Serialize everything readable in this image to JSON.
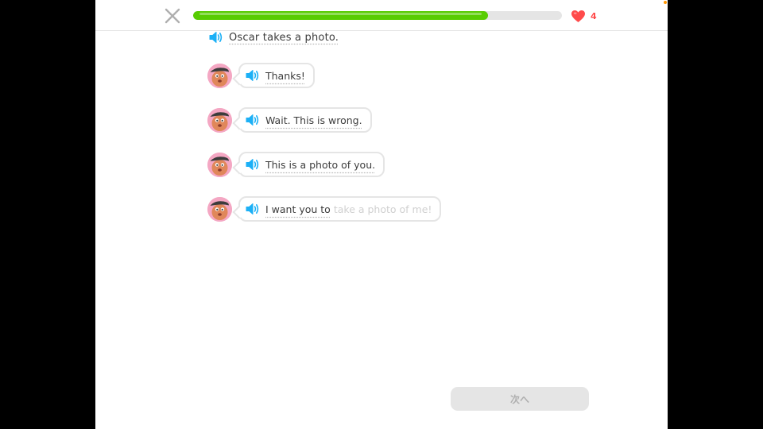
{
  "header": {
    "progress_fraction": 0.8,
    "hearts": "4",
    "colors": {
      "progress": "#58cc02",
      "heart": "#ff4b4b"
    }
  },
  "prompt": {
    "icon": "speaker-icon",
    "text": "Oscar takes a photo."
  },
  "dialogue": [
    {
      "avatar": "oscar-avatar",
      "text": "Thanks!"
    },
    {
      "avatar": "oscar-avatar",
      "text": "Wait. This is wrong."
    },
    {
      "avatar": "oscar-avatar",
      "text": "This is a photo of you."
    },
    {
      "avatar": "oscar-avatar",
      "text": "I want you to",
      "hint": "take a photo of me!"
    }
  ],
  "continue_label": "次へ"
}
